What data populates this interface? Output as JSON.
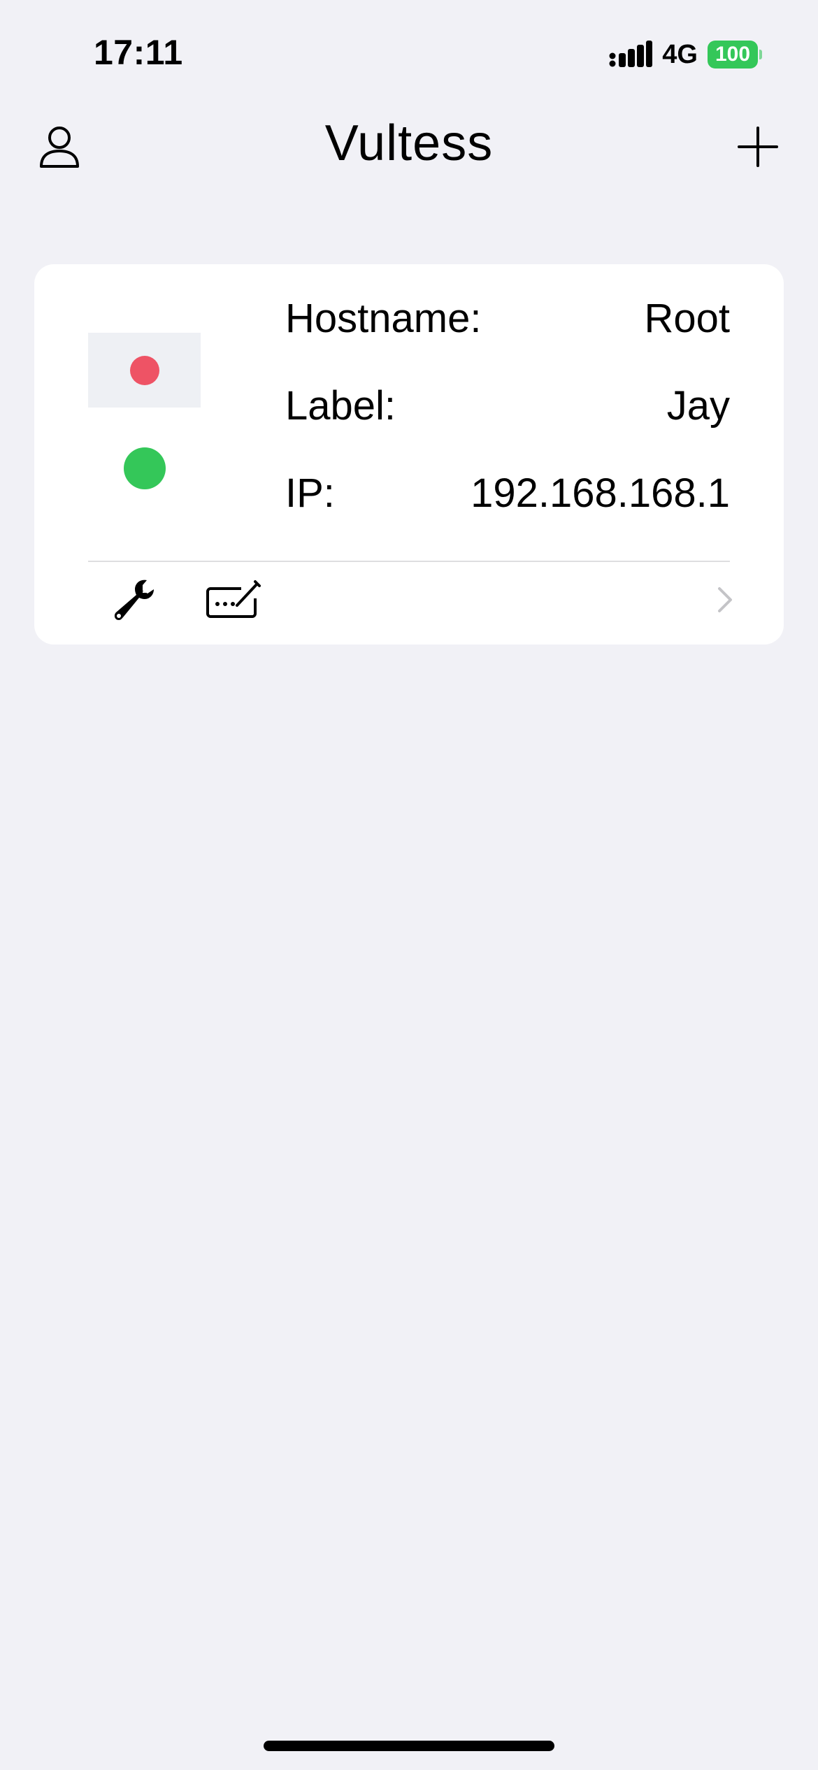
{
  "status_bar": {
    "time": "17:11",
    "network": "4G",
    "battery": "100",
    "icons": {
      "signal": "cellular-signal-icon",
      "battery": "battery-icon"
    }
  },
  "nav": {
    "title": "Vultess",
    "left_icon": "person-icon",
    "right_icon": "plus-icon"
  },
  "server": {
    "hostname_label": "Hostname:",
    "hostname_value": "Root",
    "label_label": "Label:",
    "label_value": "Jay",
    "ip_label": "IP:",
    "ip_value": "192.168.168.1",
    "flag_icon": "flag-icon",
    "status": "online",
    "actions": {
      "tools_icon": "wrench-icon",
      "console_icon": "console-edit-icon",
      "detail_icon": "chevron-right-icon"
    }
  },
  "colors": {
    "background": "#f1f1f6",
    "card": "#ffffff",
    "status_online": "#34c759",
    "flag_red": "#ee5365",
    "battery": "#34c759",
    "chevron": "#c4c4c7"
  }
}
